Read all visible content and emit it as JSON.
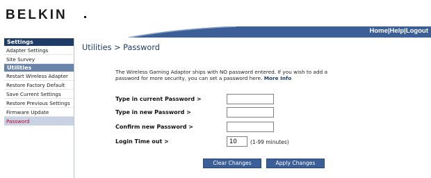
{
  "header": {
    "brand": "BELKIN",
    "links": [
      "Home",
      "Help",
      "Logout"
    ],
    "separator": "|"
  },
  "sidebar": {
    "sections": [
      {
        "title": "Settings",
        "items": [
          "Adapter Settings",
          "Site Survey"
        ]
      },
      {
        "title": "Utilities",
        "items": [
          "Restart Wireless Adapter",
          "Restore Factory Default",
          "Save Current Settings",
          "Restore Previous Settings",
          "Firmware Update",
          "Password"
        ]
      }
    ],
    "active_item": "Password"
  },
  "main": {
    "title": "Utilities > Password",
    "intro_text": "The Wireless Gaming Adaptor ships with NO password entered. If you wish to add a password for more security, you can set a password here.",
    "more_info": "More Info",
    "fields": [
      {
        "label": "Type in current Password >",
        "value": ""
      },
      {
        "label": "Type in new Password >",
        "value": ""
      },
      {
        "label": "Confirm new Password >",
        "value": ""
      },
      {
        "label": "Login Time out >",
        "value": "10",
        "unit": "(1-99 minutes)"
      }
    ],
    "buttons": {
      "clear": "Clear Changes",
      "apply": "Apply Changes"
    }
  },
  "colors": {
    "brand_blue": "#3b5f96",
    "dark_blue": "#1f3c66",
    "active_text": "#c2002f"
  }
}
